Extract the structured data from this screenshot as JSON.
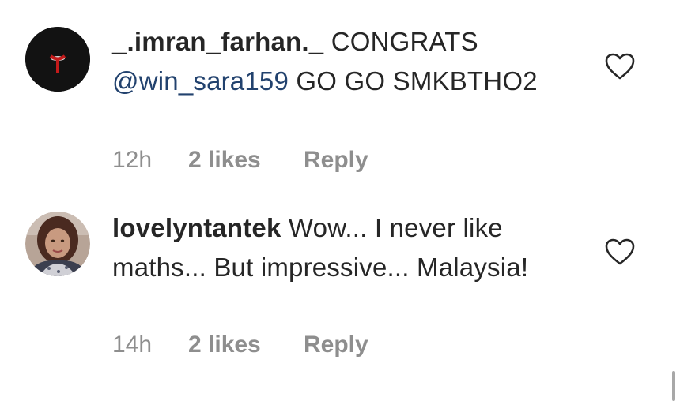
{
  "comments": [
    {
      "username": "_.imran_farhan._",
      "text_before": " CONGRATS ",
      "mention": "@win_sara159",
      "text_after": " GO GO SMKBTHO2",
      "time": "12h",
      "likes": "2 likes",
      "reply": "Reply",
      "avatar_icon": "dark-avatar-icon"
    },
    {
      "username": "lovelyntantek",
      "text_before": " Wow... I never like maths... But impressive... Malaysia!",
      "time": "14h",
      "likes": "2 likes",
      "reply": "Reply",
      "avatar_icon": "woman-portrait-avatar"
    }
  ],
  "icons": {
    "like": "heart-outline-icon"
  },
  "colors": {
    "text": "#262626",
    "meta": "#8e8e8e",
    "mention": "#22426e",
    "background": "#ffffff"
  }
}
